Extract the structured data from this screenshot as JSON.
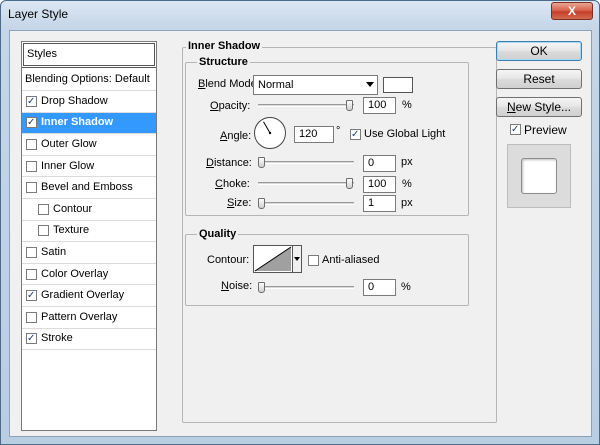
{
  "window": {
    "title": "Layer Style",
    "close_label": "X"
  },
  "styles_list": {
    "header": "Styles",
    "blending": "Blending Options: Default",
    "items": [
      {
        "label": "Drop Shadow",
        "checked": true,
        "indent": false,
        "selected": false
      },
      {
        "label": "Inner Shadow",
        "checked": true,
        "indent": false,
        "selected": true
      },
      {
        "label": "Outer Glow",
        "checked": false,
        "indent": false,
        "selected": false
      },
      {
        "label": "Inner Glow",
        "checked": false,
        "indent": false,
        "selected": false
      },
      {
        "label": "Bevel and Emboss",
        "checked": false,
        "indent": false,
        "selected": false
      },
      {
        "label": "Contour",
        "checked": false,
        "indent": true,
        "selected": false
      },
      {
        "label": "Texture",
        "checked": false,
        "indent": true,
        "selected": false
      },
      {
        "label": "Satin",
        "checked": false,
        "indent": false,
        "selected": false
      },
      {
        "label": "Color Overlay",
        "checked": false,
        "indent": false,
        "selected": false
      },
      {
        "label": "Gradient Overlay",
        "checked": true,
        "indent": false,
        "selected": false
      },
      {
        "label": "Pattern Overlay",
        "checked": false,
        "indent": false,
        "selected": false
      },
      {
        "label": "Stroke",
        "checked": true,
        "indent": false,
        "selected": false
      }
    ]
  },
  "inner_shadow": {
    "title": "Inner Shadow",
    "structure": {
      "title": "Structure",
      "blend_mode_label": "Blend Mode:",
      "blend_mode_value": "Normal",
      "shadow_color": "#ffffff",
      "opacity_label": "Opacity:",
      "opacity_value": "100",
      "opacity_unit": "%",
      "opacity_level": 1.0,
      "angle_label": "Angle:",
      "angle_value": "120",
      "angle_unit": "°",
      "use_global_light_label": "Use Global Light",
      "use_global_light": true,
      "distance_label": "Distance:",
      "distance_value": "0",
      "distance_unit": "px",
      "distance_level": 0,
      "choke_label": "Choke:",
      "choke_value": "100",
      "choke_unit": "%",
      "choke_level": 1.0,
      "size_label": "Size:",
      "size_value": "1",
      "size_unit": "px",
      "size_level": 0
    },
    "quality": {
      "title": "Quality",
      "contour_label": "Contour:",
      "anti_aliased_label": "Anti-aliased",
      "anti_aliased": false,
      "noise_label": "Noise:",
      "noise_value": "0",
      "noise_unit": "%",
      "noise_level": 0
    }
  },
  "buttons": {
    "ok": "OK",
    "reset": "Reset",
    "new_style": "New Style...",
    "preview_label": "Preview",
    "preview_checked": true
  }
}
